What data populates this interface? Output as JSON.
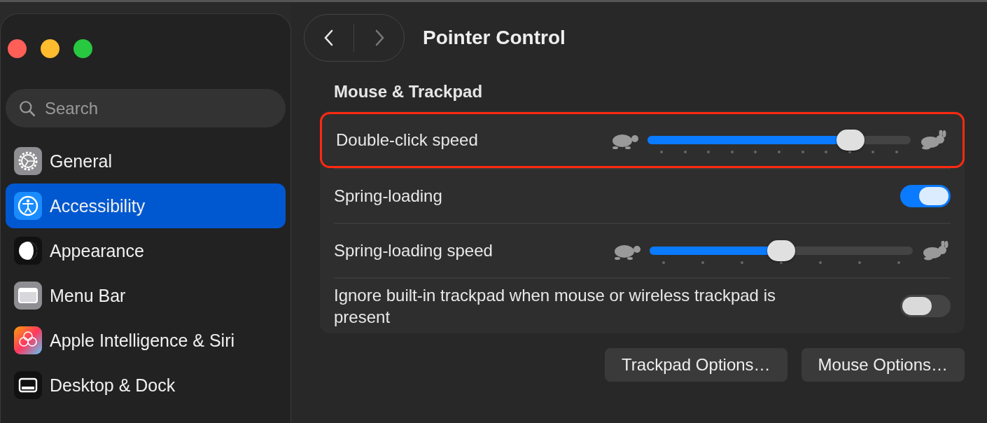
{
  "search": {
    "placeholder": "Search"
  },
  "sidebar": {
    "items": [
      {
        "label": "General",
        "selected": false
      },
      {
        "label": "Accessibility",
        "selected": true
      },
      {
        "label": "Appearance",
        "selected": false
      },
      {
        "label": "Menu Bar",
        "selected": false
      },
      {
        "label": "Apple Intelligence & Siri",
        "selected": false
      },
      {
        "label": "Desktop & Dock",
        "selected": false
      }
    ]
  },
  "page": {
    "title": "Pointer Control",
    "section": "Mouse & Trackpad",
    "rows": [
      {
        "kind": "slider",
        "label": "Double-click speed",
        "level": 0.77,
        "highlighted": true
      },
      {
        "kind": "toggle",
        "label": "Spring-loading",
        "on": true
      },
      {
        "kind": "slider",
        "label": "Spring-loading speed",
        "level": 0.5,
        "highlighted": false
      },
      {
        "kind": "toggle",
        "label": "Ignore built-in trackpad when mouse or wireless trackpad is present",
        "on": false
      }
    ],
    "buttons": [
      "Trackpad Options…",
      "Mouse Options…"
    ]
  }
}
